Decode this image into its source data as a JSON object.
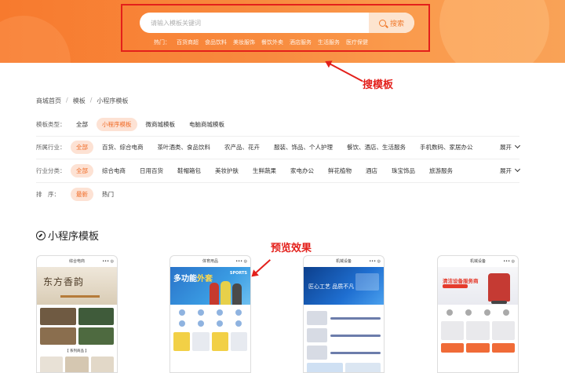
{
  "header": {
    "search_placeholder": "请输入模板关键词",
    "search_button": "搜索",
    "hot_label": "热门：",
    "hot_items": [
      "百货商超",
      "食品饮料",
      "美妆服饰",
      "餐饮外卖",
      "酒店服务",
      "生活服务",
      "医疗保健"
    ]
  },
  "annotations": {
    "search": "搜模板",
    "preview": "预览效果"
  },
  "breadcrumb": [
    "商城首页",
    "模板",
    "小程序模板"
  ],
  "filters": [
    {
      "label": "模板类型：",
      "options": [
        "全部",
        "小程序模板",
        "微商城模板",
        "电脑商城模板"
      ],
      "active": 1,
      "expand": ""
    },
    {
      "label": "所属行业：",
      "options": [
        "全部",
        "百货、综合电商",
        "茶叶酒类、食品饮料",
        "农产品、花卉",
        "服装、饰品、个人护理",
        "餐饮、酒店、生活服务",
        "手机数码、家居办公"
      ],
      "active": 0,
      "expand": "展开"
    },
    {
      "label": "行业分类：",
      "options": [
        "全部",
        "综合电商",
        "日用百货",
        "鞋帽箱包",
        "美妆护肤",
        "生鲜蔬果",
        "家电办公",
        "鲜花植物",
        "酒店",
        "珠宝饰品",
        "旅游服务"
      ],
      "active": 0,
      "expand": "展开"
    },
    {
      "label": "排　序：",
      "options": [
        "最新",
        "热门"
      ],
      "active": 0,
      "expand": ""
    }
  ],
  "section": {
    "title": "小程序模板"
  },
  "cards": [
    {
      "header": "综合电商",
      "hero_text": "东方香韵",
      "tag": "【 系列商品 】"
    },
    {
      "header": "体育用品",
      "hero_text_a": "多功能",
      "hero_text_b": "外套",
      "hero_badge": "SPORTS"
    },
    {
      "header": "机械设备",
      "hero_text": "匠心工艺 品质不凡"
    },
    {
      "header": "机械设备",
      "hero_text": "清洁设备服务商"
    }
  ]
}
